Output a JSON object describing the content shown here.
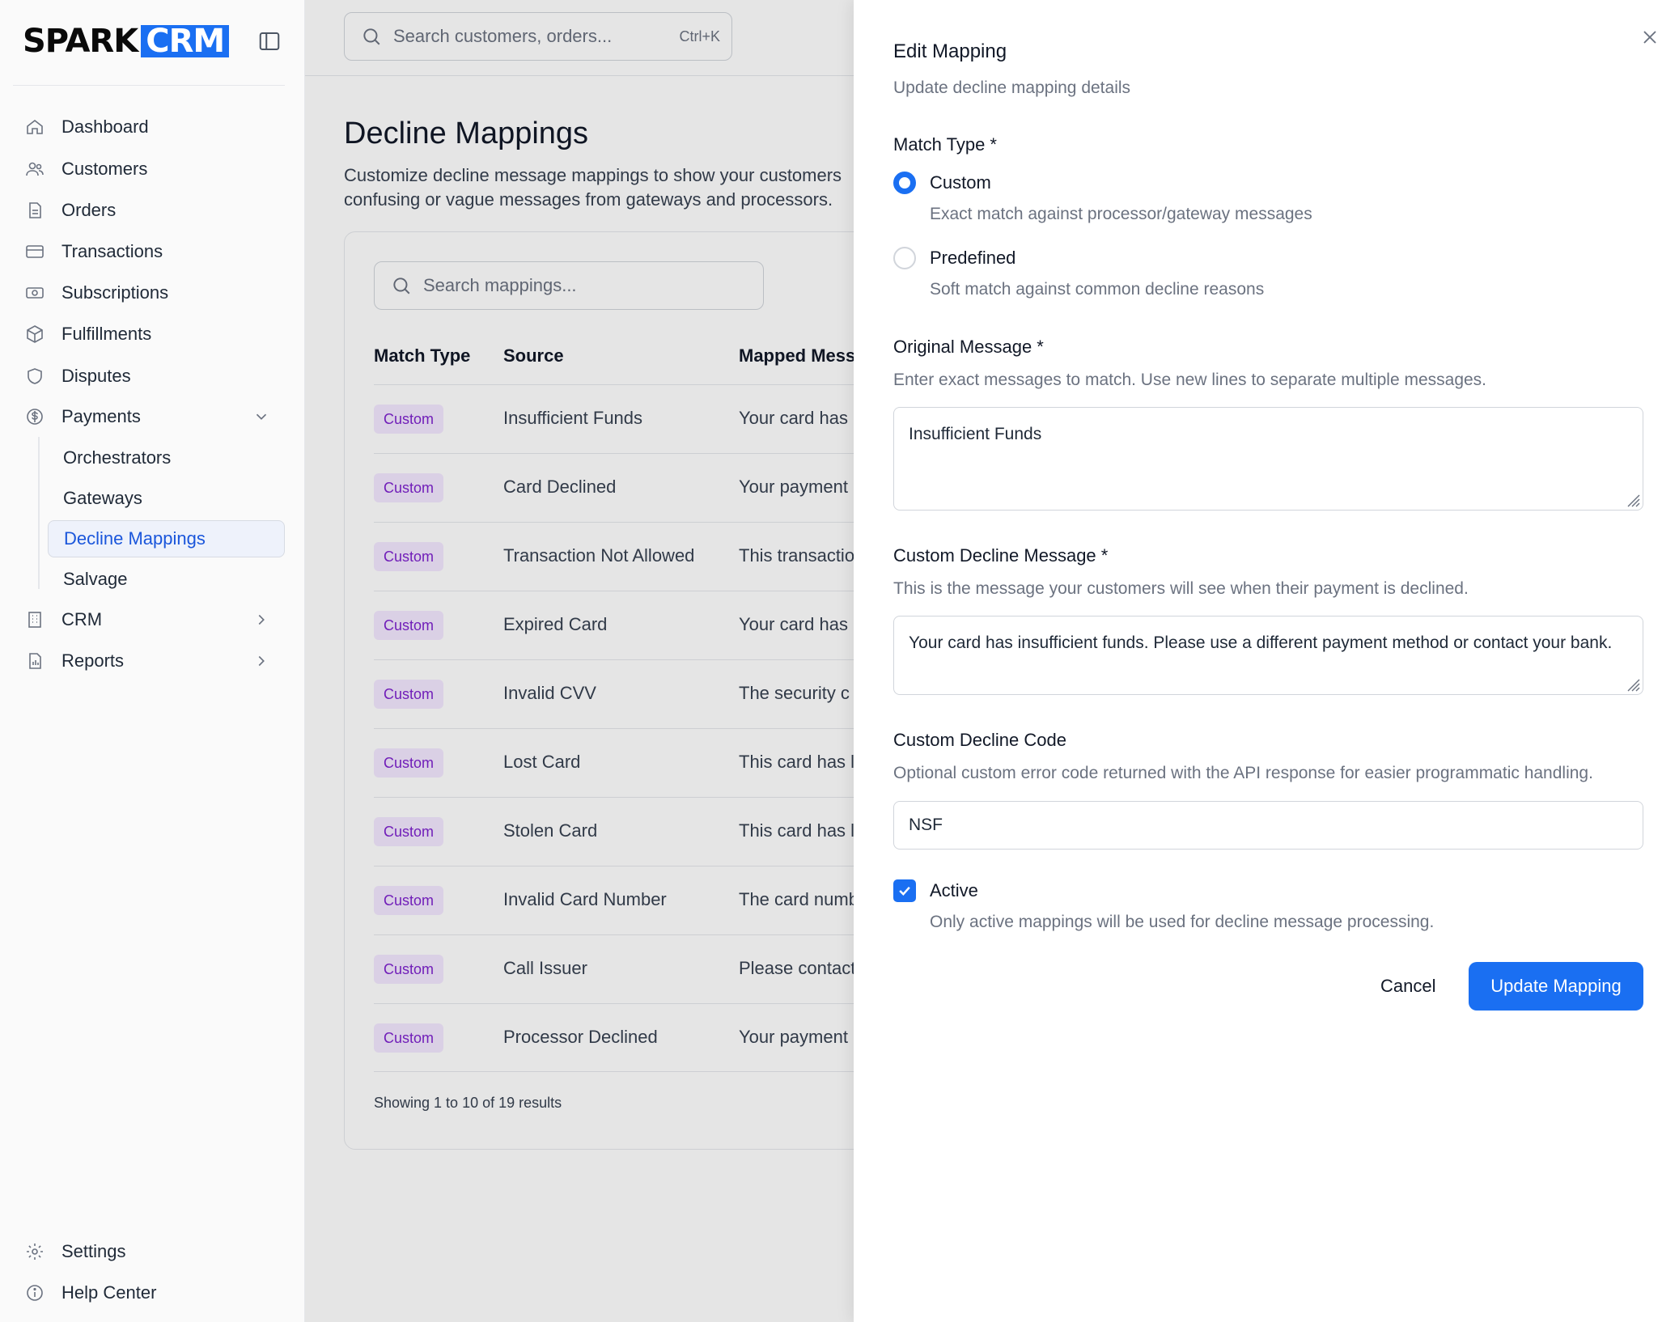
{
  "brand": {
    "part1": "SPARK",
    "part2": "CRM"
  },
  "sidebar": {
    "items": [
      {
        "label": "Dashboard",
        "icon": "home-icon"
      },
      {
        "label": "Customers",
        "icon": "users-icon"
      },
      {
        "label": "Orders",
        "icon": "document-icon"
      },
      {
        "label": "Transactions",
        "icon": "credit-card-icon"
      },
      {
        "label": "Subscriptions",
        "icon": "money-icon"
      },
      {
        "label": "Fulfillments",
        "icon": "box-icon"
      },
      {
        "label": "Disputes",
        "icon": "shield-icon"
      },
      {
        "label": "Payments",
        "icon": "dollar-circle-icon"
      },
      {
        "label": "CRM",
        "icon": "building-icon"
      },
      {
        "label": "Reports",
        "icon": "report-icon"
      }
    ],
    "payments_sub": [
      "Orchestrators",
      "Gateways",
      "Decline Mappings",
      "Salvage"
    ],
    "footer": [
      {
        "label": "Settings",
        "icon": "gear-icon"
      },
      {
        "label": "Help Center",
        "icon": "info-icon"
      }
    ]
  },
  "topbar": {
    "search_placeholder": "Search customers, orders...",
    "shortcut": "Ctrl+K"
  },
  "page": {
    "title": "Decline Mappings",
    "description": "Customize decline message mappings to show your customers confusing or vague messages from gateways and processors.",
    "search_placeholder": "Search mappings...",
    "columns": [
      "Match Type",
      "Source",
      "Mapped Mess"
    ],
    "rows": [
      {
        "type": "Custom",
        "source": "Insufficient Funds",
        "mapped": "Your card has"
      },
      {
        "type": "Custom",
        "source": "Card Declined",
        "mapped": "Your payment"
      },
      {
        "type": "Custom",
        "source": "Transaction Not Allowed",
        "mapped": "This transactio"
      },
      {
        "type": "Custom",
        "source": "Expired Card",
        "mapped": "Your card has"
      },
      {
        "type": "Custom",
        "source": "Invalid CVV",
        "mapped": "The security c"
      },
      {
        "type": "Custom",
        "source": "Lost Card",
        "mapped": "This card has l"
      },
      {
        "type": "Custom",
        "source": "Stolen Card",
        "mapped": "This card has l"
      },
      {
        "type": "Custom",
        "source": "Invalid Card Number",
        "mapped": "The card numb"
      },
      {
        "type": "Custom",
        "source": "Call Issuer",
        "mapped": "Please contact"
      },
      {
        "type": "Custom",
        "source": "Processor Declined",
        "mapped": "Your payment"
      }
    ],
    "results_text": "Showing 1 to 10 of 19 results"
  },
  "drawer": {
    "title": "Edit Mapping",
    "subtitle": "Update decline mapping details",
    "match_type_label": "Match Type *",
    "option_custom": "Custom",
    "option_custom_help": "Exact match against processor/gateway messages",
    "option_predefined": "Predefined",
    "option_predefined_help": "Soft match against common decline reasons",
    "original_label": "Original Message *",
    "original_help": "Enter exact messages to match. Use new lines to separate multiple messages.",
    "original_value": "Insufficient Funds",
    "custom_msg_label": "Custom Decline Message *",
    "custom_msg_help": "This is the message your customers will see when their payment is declined.",
    "custom_msg_value": "Your card has insufficient funds. Please use a different payment method or contact your bank.",
    "code_label": "Custom Decline Code",
    "code_help": "Optional custom error code returned with the API response for easier programmatic handling.",
    "code_value": "NSF",
    "active_label": "Active",
    "active_help": "Only active mappings will be used for decline message processing.",
    "cancel": "Cancel",
    "update": "Update Mapping"
  },
  "colors": {
    "accent": "#1a6ff2",
    "badge_bg": "#f3e8ff",
    "badge_text": "#7e22ce"
  }
}
